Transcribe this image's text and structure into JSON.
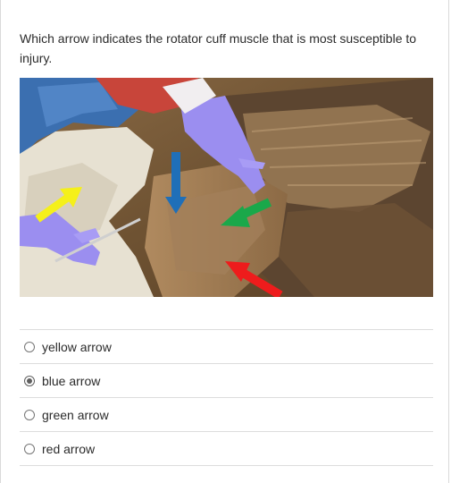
{
  "question": {
    "text": "Which arrow indicates the rotator cuff muscle that is most susceptible to injury."
  },
  "figure": {
    "arrows": [
      {
        "name": "yellow-arrow",
        "color": "#f5f01a"
      },
      {
        "name": "blue-arrow",
        "color": "#1f6fb8"
      },
      {
        "name": "green-arrow",
        "color": "#1aa84a"
      },
      {
        "name": "red-arrow",
        "color": "#ee1c1c"
      }
    ],
    "glove_color": "#9b8ef0"
  },
  "options": [
    {
      "label": "yellow arrow",
      "selected": false
    },
    {
      "label": "blue arrow",
      "selected": true
    },
    {
      "label": "green arrow",
      "selected": false
    },
    {
      "label": "red arrow",
      "selected": false
    }
  ]
}
